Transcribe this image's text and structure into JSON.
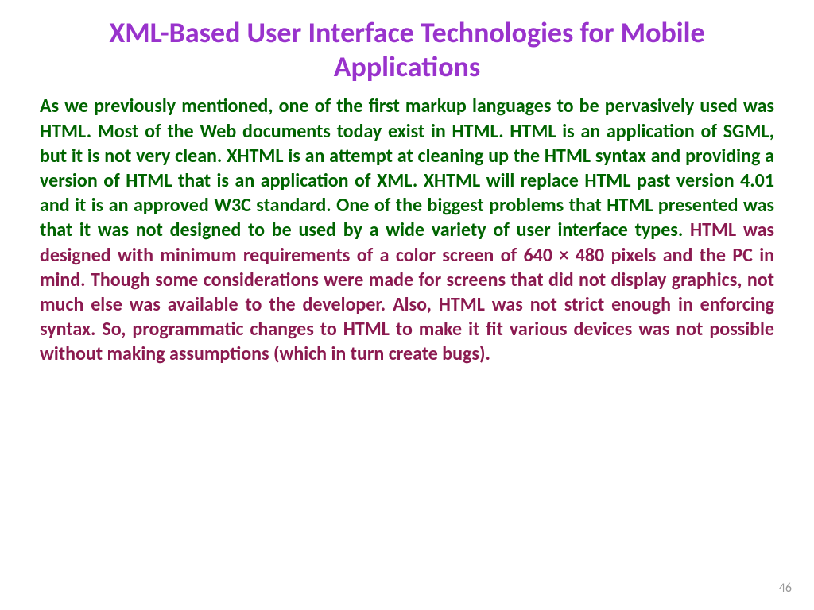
{
  "slide": {
    "title": "XML-Based User Interface Technologies for Mobile Applications",
    "paragraph_green": "As we previously mentioned, one of the first markup languages to be pervasively used was HTML. Most of the Web documents today exist in HTML. HTML is an application of SGML, but it is not very clean. XHTML is an attempt at cleaning up the HTML syntax and providing a version of HTML that is an application of XML. XHTML will replace HTML past version 4.01 and it is an approved W3C standard. One of the biggest problems that HTML presented was that it was not designed to be used by a wide variety of user interface types. ",
    "paragraph_maroon": "HTML was designed with minimum requirements of a color screen of 640 × 480 pixels and the PC in mind. Though some considerations were made for screens that did not display graphics, not much else was available to the developer. Also, HTML was not strict enough in enforcing syntax. So, programmatic changes to HTML to make it fit various devices was not possible without making assumptions (which in turn create bugs).",
    "page_number": "46"
  }
}
